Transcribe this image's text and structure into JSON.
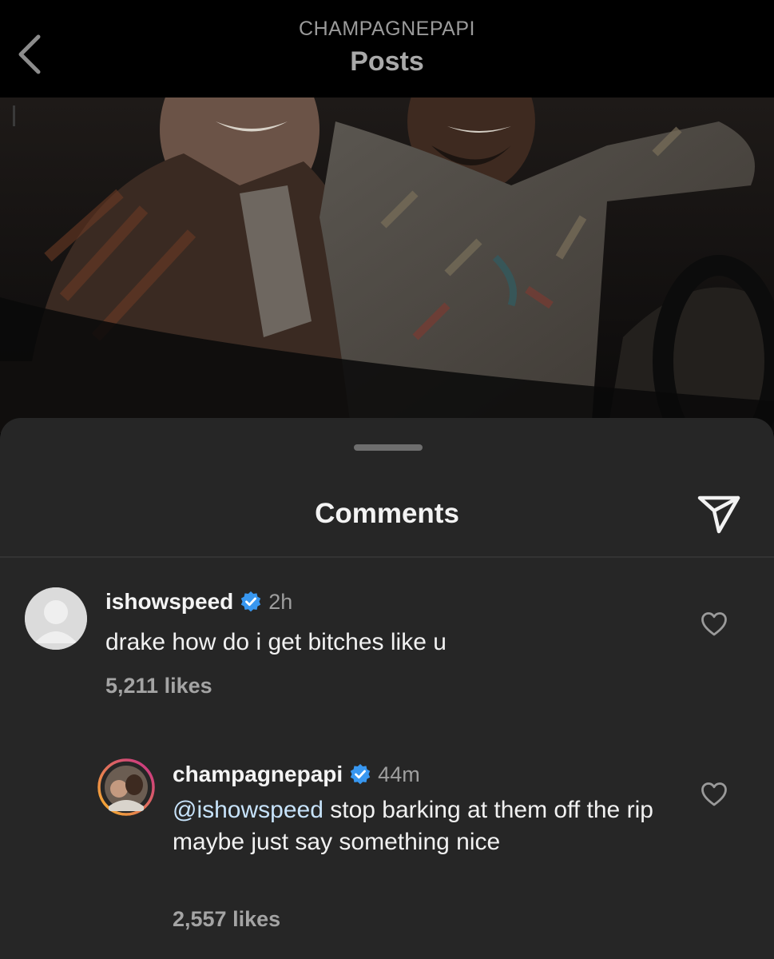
{
  "header": {
    "account": "CHAMPAGNEPAPI",
    "title": "Posts"
  },
  "sheet": {
    "title": "Comments"
  },
  "comments": [
    {
      "username": "ishowspeed",
      "verified": true,
      "time": "2h",
      "text": "drake how do i get bitches like u",
      "likes": "5,211 likes"
    },
    {
      "username": "champagnepapi",
      "verified": true,
      "time": "44m",
      "mention": "@ishowspeed",
      "text": " stop barking at them off the rip maybe just say something nice",
      "likes": "2,557 likes"
    }
  ],
  "colors": {
    "background": "#000000",
    "sheet": "#262626",
    "verified_badge": "#3897f0",
    "story_ring_start": "#f9b52b",
    "story_ring_end": "#c72c8a"
  },
  "icons": {
    "back": "chevron-left-icon",
    "share": "paper-plane-icon",
    "like": "heart-outline-icon",
    "verified": "verified-badge-icon"
  }
}
